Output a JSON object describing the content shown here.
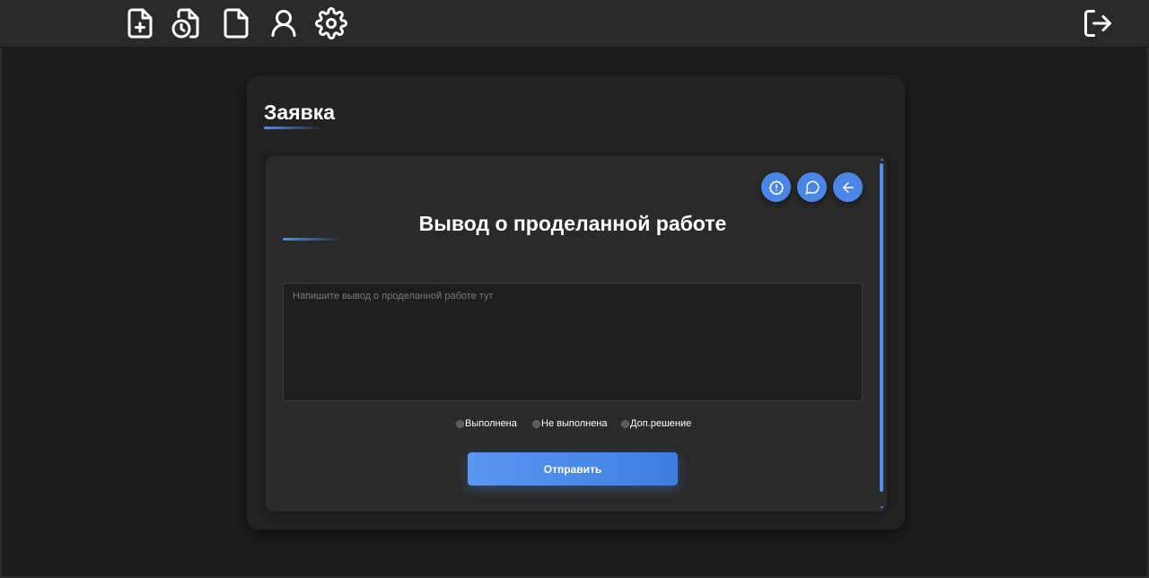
{
  "topbar": {
    "nav_icons": [
      "file-plus-icon",
      "file-history-icon",
      "file-icon",
      "user-icon",
      "gear-icon"
    ],
    "logout_icon": "logout-icon"
  },
  "card": {
    "title": "Заявка"
  },
  "form": {
    "action_icons": [
      "alert-circle-icon",
      "chat-bubble-icon",
      "arrow-left-icon"
    ],
    "title": "Вывод о проделанной работе",
    "textarea_placeholder": "Напишите вывод о проделанной работе тут",
    "textarea_value": "",
    "radio_options": [
      {
        "label": "Выполнена",
        "checked": false
      },
      {
        "label": "Не выполнена",
        "checked": false
      },
      {
        "label": "Доп.решение",
        "checked": false
      }
    ],
    "submit_label": "Отправить"
  },
  "colors": {
    "accent": "#4a86e8",
    "background": "#1c1c1c",
    "topbar": "#2a2a2a",
    "card": "#222222",
    "inner_card": "#2a2a2a"
  }
}
